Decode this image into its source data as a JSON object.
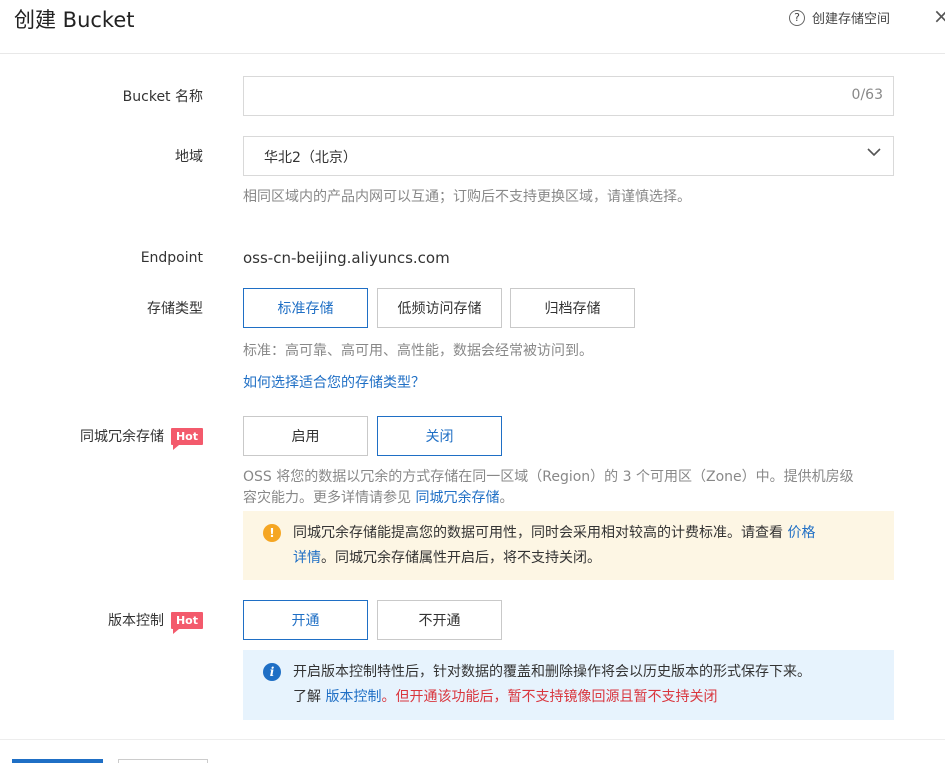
{
  "dialog": {
    "title": "创建 Bucket",
    "help_link": "创建存储空间",
    "close_symbol": "×"
  },
  "bucket_name": {
    "label": "Bucket 名称",
    "value": "",
    "counter": "0/63"
  },
  "region": {
    "label": "地域",
    "selected": "华北2（北京）",
    "hint": "相同区域内的产品内网可以互通；订购后不支持更换区域，请谨慎选择。"
  },
  "endpoint": {
    "label": "Endpoint",
    "value": "oss-cn-beijing.aliyuncs.com"
  },
  "storage_class": {
    "label": "存储类型",
    "options": [
      "标准存储",
      "低频访问存储",
      "归档存储"
    ],
    "selected": "标准存储",
    "hint": "标准：高可靠、高可用、高性能，数据会经常被访问到。",
    "help_link": "如何选择适合您的存储类型？"
  },
  "zone_redundant": {
    "label": "同城冗余存储",
    "badge": "Hot",
    "options": [
      "启用",
      "关闭"
    ],
    "selected": "关闭",
    "desc_line1": "OSS 将您的数据以冗余的方式存储在同一区域（Region）的 3 个可用区（Zone）中。提供机房级",
    "desc_line2_prefix": "容灾能力。更多详情请参见 ",
    "desc_link": "同城冗余存储",
    "desc_line2_suffix": "。",
    "warning_icon": "!",
    "warning_line1": "同城冗余存储能提高您的数据可用性，同时会采用相对较高的计费标准。请查看 ",
    "warning_link_1": "价格",
    "warning_link_2": "详情",
    "warning_line2_suffix": "。同城冗余存储属性开启后，将不支持关闭。",
    "warning_color": "#f5a623"
  },
  "versioning": {
    "label": "版本控制",
    "badge": "Hot",
    "options": [
      "开通",
      "不开通"
    ],
    "selected": "开通",
    "info_icon": "i",
    "info_line1": "开启版本控制特性后，针对数据的覆盖和删除操作将会以历史版本的形式保存下来。",
    "info_line2_prefix": "了解 ",
    "info_link": "版本控制",
    "info_red": "。但开通该功能后，暂不支持镜像回源且暂不支持关闭",
    "info_color": "#1f6fc5"
  },
  "colors": {
    "accent": "#1f6fc5",
    "hot_badge": "#f35a6c",
    "warning_bg": "#fdf6e4",
    "info_bg": "#e7f3fd",
    "danger_text": "#d9363e"
  }
}
